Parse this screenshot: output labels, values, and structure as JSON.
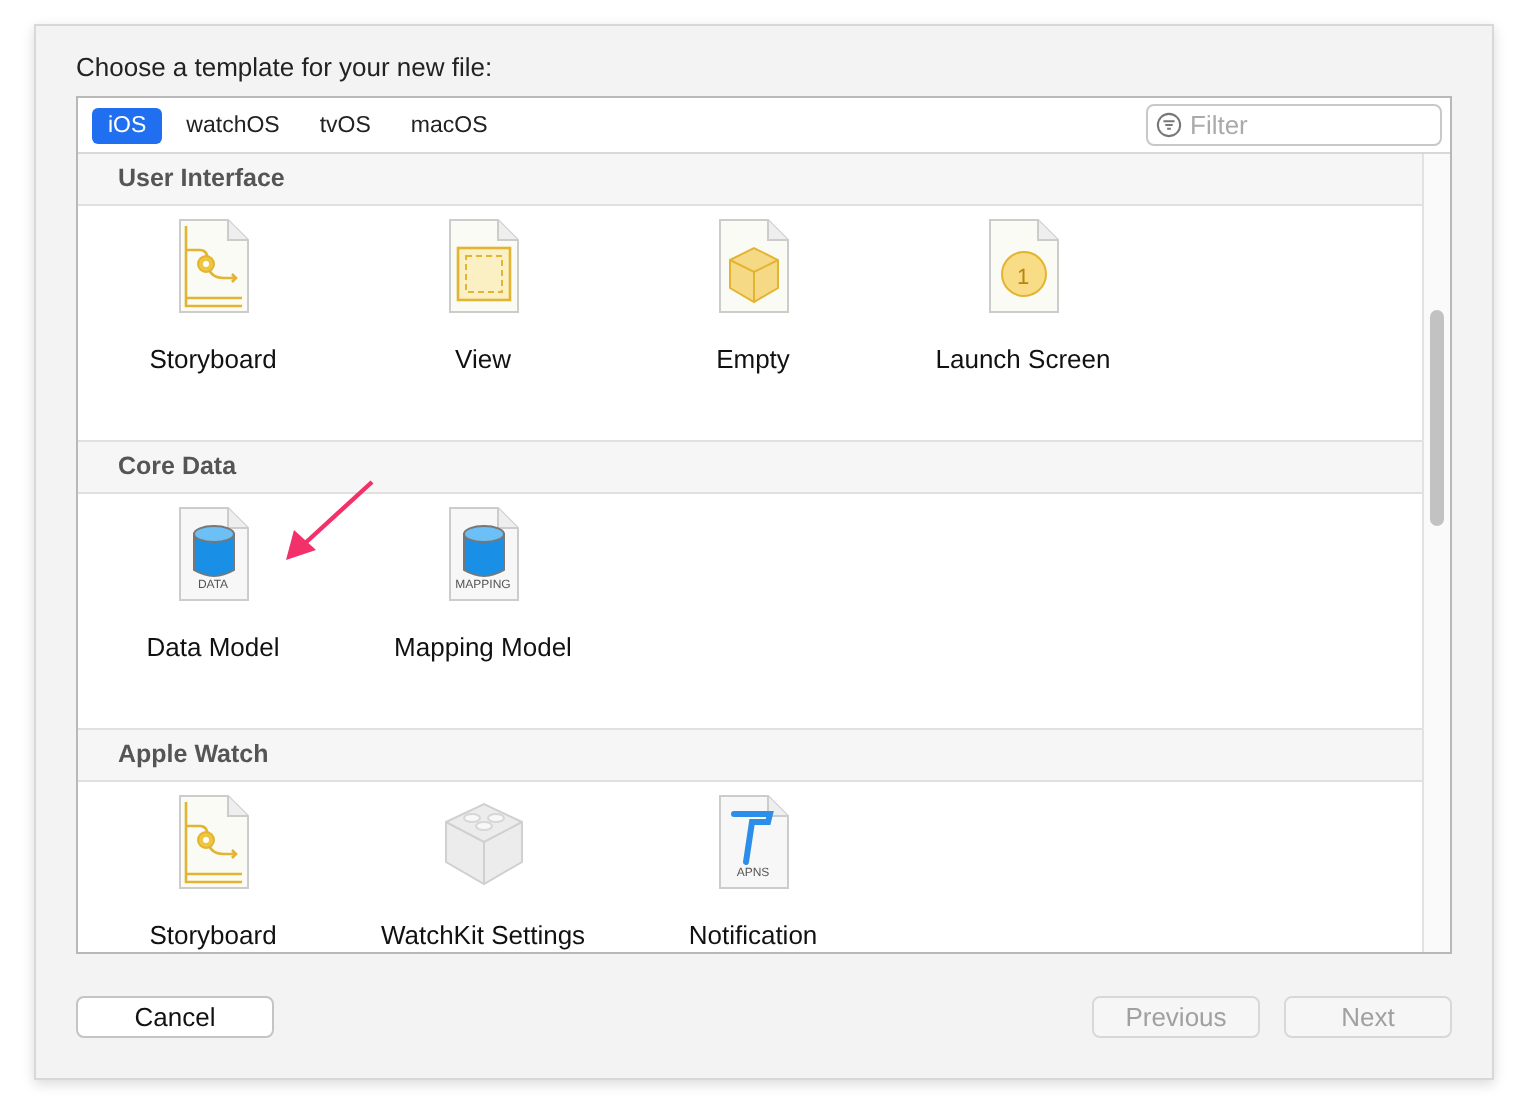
{
  "prompt": "Choose a template for your new file:",
  "tabs": [
    {
      "label": "iOS",
      "selected": true
    },
    {
      "label": "watchOS",
      "selected": false
    },
    {
      "label": "tvOS",
      "selected": false
    },
    {
      "label": "macOS",
      "selected": false
    }
  ],
  "filter": {
    "placeholder": "Filter"
  },
  "sections": [
    {
      "title": "User Interface",
      "items": [
        {
          "kind": "storyboard",
          "label": "Storyboard"
        },
        {
          "kind": "view",
          "label": "View"
        },
        {
          "kind": "empty",
          "label": "Empty"
        },
        {
          "kind": "launch",
          "label": "Launch Screen",
          "badge": "1"
        }
      ]
    },
    {
      "title": "Core Data",
      "items": [
        {
          "kind": "database",
          "label": "Data Model",
          "badge": "DATA"
        },
        {
          "kind": "database",
          "label": "Mapping Model",
          "badge": "MAPPING"
        }
      ]
    },
    {
      "title": "Apple Watch",
      "items": [
        {
          "kind": "storyboard",
          "label": "Storyboard"
        },
        {
          "kind": "brick",
          "label": "WatchKit Settings"
        },
        {
          "kind": "hammer",
          "label": "Notification",
          "badge": "APNS"
        }
      ]
    }
  ],
  "buttons": [
    {
      "label": "Cancel",
      "disabled": false
    },
    {
      "label": "Previous",
      "disabled": true
    },
    {
      "label": "Next",
      "disabled": true
    }
  ]
}
